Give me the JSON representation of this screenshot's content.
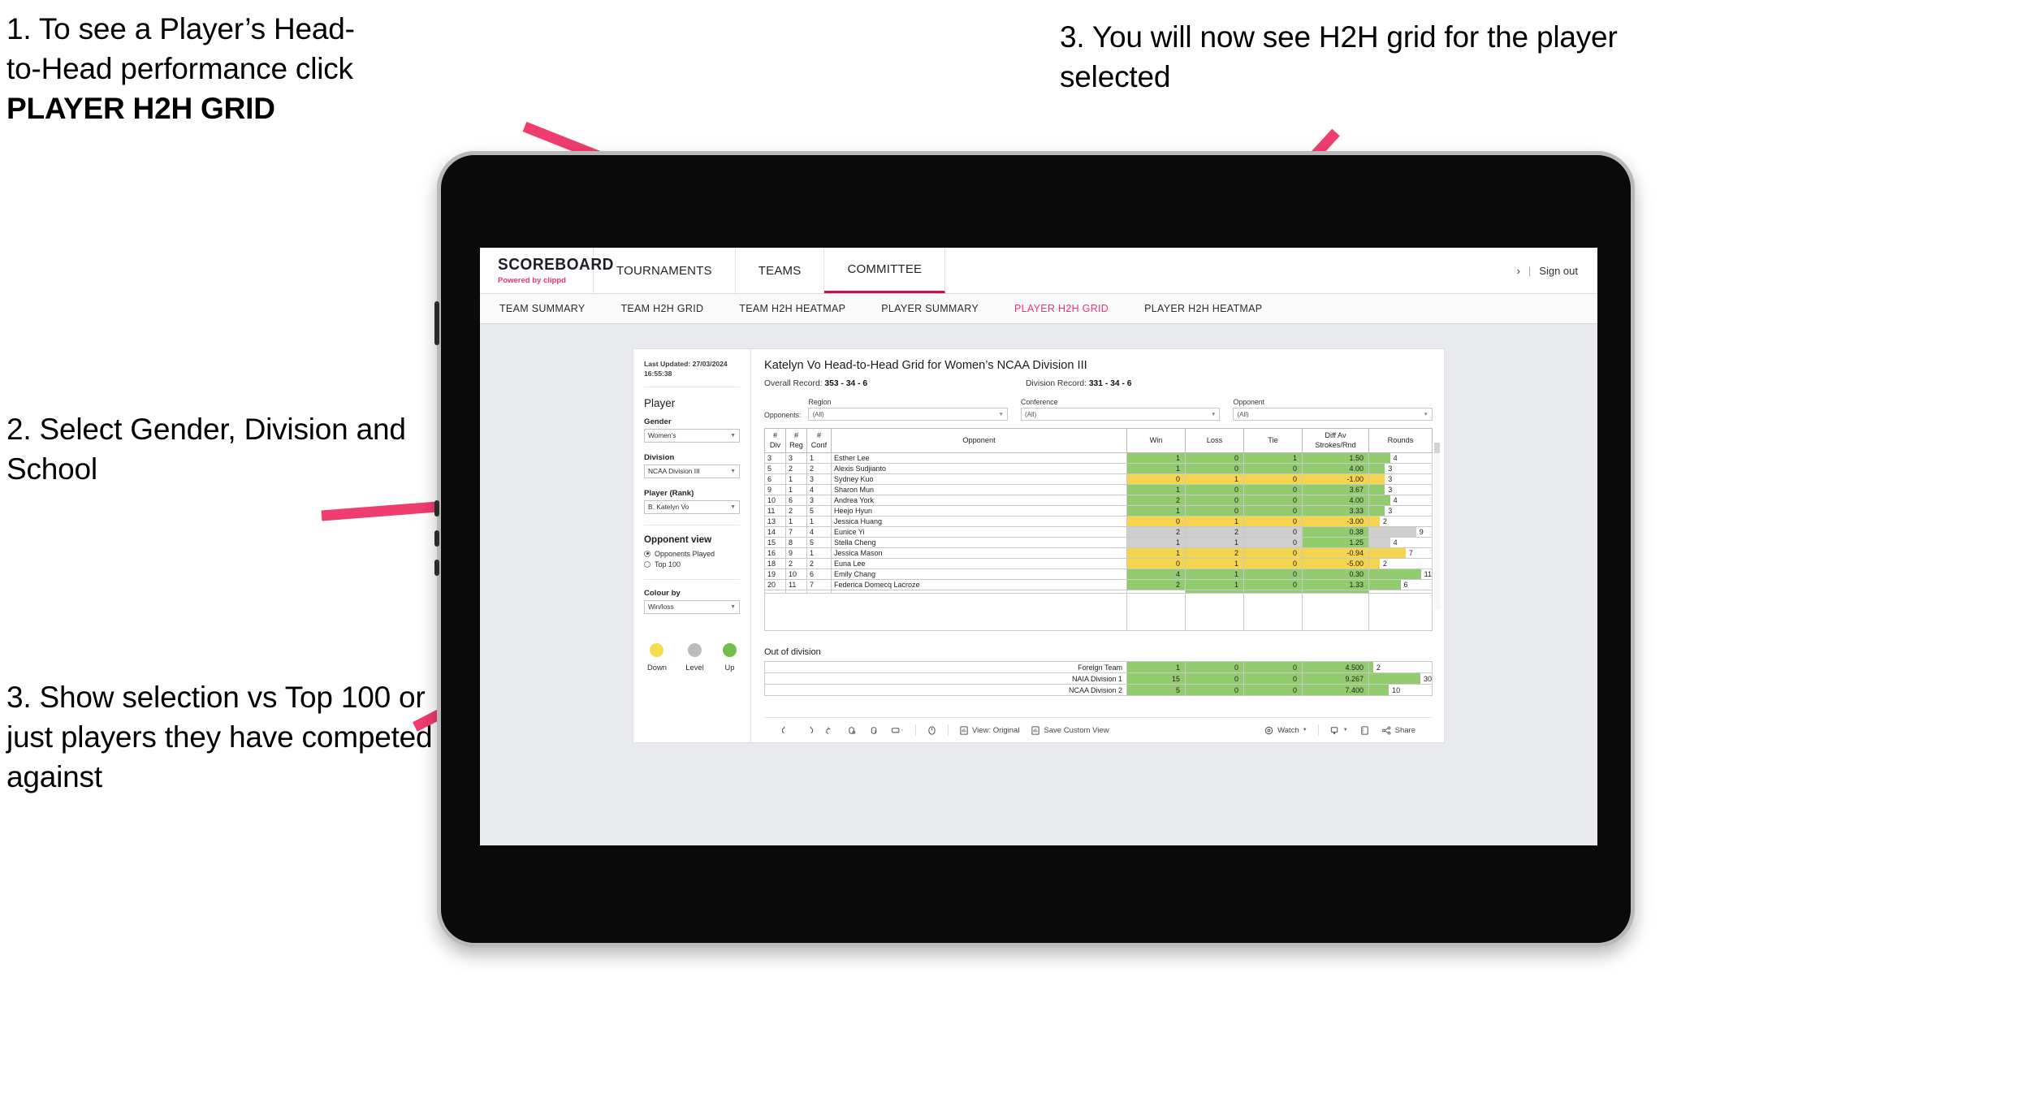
{
  "annotations": {
    "a1_line1": "1. To see a Player’s Head-",
    "a1_line2": "to-Head performance click",
    "a1_bold": "PLAYER H2H GRID",
    "a2": "2. Select Gender, Division and School",
    "a3": "3. Show selection vs Top 100 or just players they have competed against",
    "a4": "3. You will now see H2H grid for the player selected"
  },
  "header": {
    "logo_main": "SCOREBOARD",
    "logo_sub_pre": "Powered by ",
    "logo_sub_brand": "clippd",
    "nav": [
      {
        "label": "TOURNAMENTS",
        "active": false
      },
      {
        "label": "TEAMS",
        "active": false
      },
      {
        "label": "COMMITTEE",
        "active": true
      }
    ],
    "account_icon": "›",
    "separator": "|",
    "sign_out": "Sign out"
  },
  "subnav": [
    {
      "label": "TEAM SUMMARY",
      "active": false
    },
    {
      "label": "TEAM H2H GRID",
      "active": false
    },
    {
      "label": "TEAM H2H HEATMAP",
      "active": false
    },
    {
      "label": "PLAYER SUMMARY",
      "active": false
    },
    {
      "label": "PLAYER H2H GRID",
      "active": true
    },
    {
      "label": "PLAYER H2H HEATMAP",
      "active": false
    }
  ],
  "sidebar": {
    "last_updated": "Last Updated: 27/03/2024 16:55:38",
    "player_section_title": "Player",
    "filters": [
      {
        "label": "Gender",
        "value": "Women's"
      },
      {
        "label": "Division",
        "value": "NCAA Division III"
      },
      {
        "label": "Player (Rank)",
        "value": "B. Katelyn Vo"
      }
    ],
    "opponent_view_title": "Opponent view",
    "opponent_view_options": [
      {
        "label": "Opponents Played",
        "selected": true
      },
      {
        "label": "Top 100",
        "selected": false
      }
    ],
    "colour_by_label": "Colour by",
    "colour_by_value": "Win/loss",
    "legend": [
      {
        "label": "Down",
        "color": "#f5dd52"
      },
      {
        "label": "Level",
        "color": "#bcbcbc"
      },
      {
        "label": "Up",
        "color": "#6fbf4a"
      }
    ]
  },
  "main": {
    "title": "Katelyn Vo Head-to-Head Grid for Women’s NCAA Division III",
    "overall_record_label": "Overall Record: ",
    "overall_record_value": "353 -  34 - 6",
    "division_record_label": "Division Record: ",
    "division_record_value": "331 -  34 - 6",
    "opponents_label": "Opponents:",
    "opponent_filters": [
      {
        "label": "Region",
        "value": "(All)"
      },
      {
        "label": "Conference",
        "value": "(All)"
      },
      {
        "label": "Opponent",
        "value": "(All)"
      }
    ],
    "out_of_division_title": "Out of division"
  },
  "chart_data": {
    "type": "table",
    "title": "Katelyn Vo Head-to-Head Grid for Women’s NCAA Division III",
    "columns": [
      "# Div",
      "# Reg",
      "# Conf",
      "Opponent",
      "Win",
      "Loss",
      "Tie",
      "Diff Av Strokes/Rnd",
      "Rounds"
    ],
    "column_headers_two_line": [
      [
        "#",
        "Div"
      ],
      [
        "#",
        "Reg"
      ],
      [
        "#",
        "Conf"
      ],
      [
        "Opponent",
        ""
      ],
      [
        "Win",
        ""
      ],
      [
        "Loss",
        ""
      ],
      [
        "Tie",
        ""
      ],
      [
        "Diff Av",
        "Strokes/Rnd"
      ],
      [
        "Rounds",
        ""
      ]
    ],
    "rounds_max": 12,
    "rows": [
      {
        "div": "3",
        "reg": "3",
        "conf": "1",
        "opponent": "Esther Lee",
        "win": "1",
        "loss": "0",
        "tie": "1",
        "diff": "1.50",
        "rounds": 4,
        "color": "#93cc6e"
      },
      {
        "div": "5",
        "reg": "2",
        "conf": "2",
        "opponent": "Alexis Sudjianto",
        "win": "1",
        "loss": "0",
        "tie": "0",
        "diff": "4.00",
        "rounds": 3,
        "color": "#93cc6e"
      },
      {
        "div": "6",
        "reg": "1",
        "conf": "3",
        "opponent": "Sydney Kuo",
        "win": "0",
        "loss": "1",
        "tie": "0",
        "diff": "-1.00",
        "rounds": 3,
        "color": "#f5d44e"
      },
      {
        "div": "9",
        "reg": "1",
        "conf": "4",
        "opponent": "Sharon Mun",
        "win": "1",
        "loss": "0",
        "tie": "0",
        "diff": "3.67",
        "rounds": 3,
        "color": "#93cc6e"
      },
      {
        "div": "10",
        "reg": "6",
        "conf": "3",
        "opponent": "Andrea York",
        "win": "2",
        "loss": "0",
        "tie": "0",
        "diff": "4.00",
        "rounds": 4,
        "color": "#93cc6e"
      },
      {
        "div": "11",
        "reg": "2",
        "conf": "5",
        "opponent": "Heejo Hyun",
        "win": "1",
        "loss": "0",
        "tie": "0",
        "diff": "3.33",
        "rounds": 3,
        "color": "#93cc6e"
      },
      {
        "div": "13",
        "reg": "1",
        "conf": "1",
        "opponent": "Jessica Huang",
        "win": "0",
        "loss": "1",
        "tie": "0",
        "diff": "-3.00",
        "rounds": 2,
        "color": "#f5d44e"
      },
      {
        "div": "14",
        "reg": "7",
        "conf": "4",
        "opponent": "Eunice Yi",
        "win": "2",
        "loss": "2",
        "tie": "0",
        "diff": "0.38",
        "rounds": 9,
        "color": "#cfcfcf",
        "diff_color": "#93cc6e"
      },
      {
        "div": "15",
        "reg": "8",
        "conf": "5",
        "opponent": "Stella Cheng",
        "win": "1",
        "loss": "1",
        "tie": "0",
        "diff": "1.25",
        "rounds": 4,
        "color": "#cfcfcf",
        "diff_color": "#93cc6e"
      },
      {
        "div": "16",
        "reg": "9",
        "conf": "1",
        "opponent": "Jessica Mason",
        "win": "1",
        "loss": "2",
        "tie": "0",
        "diff": "-0.94",
        "rounds": 7,
        "color": "#f5d44e"
      },
      {
        "div": "18",
        "reg": "2",
        "conf": "2",
        "opponent": "Euna Lee",
        "win": "0",
        "loss": "1",
        "tie": "0",
        "diff": "-5.00",
        "rounds": 2,
        "color": "#f5d44e"
      },
      {
        "div": "19",
        "reg": "10",
        "conf": "6",
        "opponent": "Emily Chang",
        "win": "4",
        "loss": "1",
        "tie": "0",
        "diff": "0.30",
        "rounds": 11,
        "color": "#93cc6e"
      },
      {
        "div": "20",
        "reg": "11",
        "conf": "7",
        "opponent": "Federica Domecq Lacroze",
        "win": "2",
        "loss": "1",
        "tie": "0",
        "diff": "1.33",
        "rounds": 6,
        "color": "#93cc6e"
      }
    ],
    "out_of_division": {
      "rounds_max": 32,
      "rows": [
        {
          "name": "Foreign Team",
          "win": "1",
          "loss": "0",
          "tie": "0",
          "diff": "4.500",
          "rounds": 2,
          "color": "#93cc6e"
        },
        {
          "name": "NAIA Division 1",
          "win": "15",
          "loss": "0",
          "tie": "0",
          "diff": "9.267",
          "rounds": 30,
          "color": "#93cc6e"
        },
        {
          "name": "NCAA Division 2",
          "win": "5",
          "loss": "0",
          "tie": "0",
          "diff": "7.400",
          "rounds": 10,
          "color": "#93cc6e"
        }
      ]
    }
  },
  "toolbar": {
    "view_label": "View: Original",
    "save_label": "Save Custom View",
    "watch_label": "Watch",
    "share_label": "Share"
  },
  "colors": {
    "accent_pink": "#e8356d",
    "arrow_pink": "#ee3d6e",
    "active_tab_underline": "#c8104a",
    "green": "#93cc6e",
    "yellow": "#f5d44e",
    "grey": "#cfcfcf"
  }
}
